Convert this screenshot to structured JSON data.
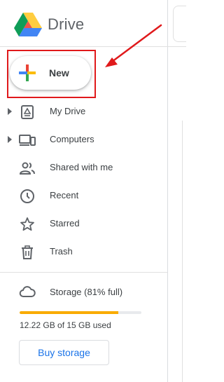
{
  "app": {
    "brand": "Drive"
  },
  "new_button": {
    "label": "New"
  },
  "nav": {
    "items": [
      {
        "id": "my-drive",
        "label": "My Drive",
        "icon": "drive-folder-icon",
        "expandable": true
      },
      {
        "id": "computers",
        "label": "Computers",
        "icon": "computers-icon",
        "expandable": true
      },
      {
        "id": "shared",
        "label": "Shared with me",
        "icon": "people-icon",
        "expandable": false
      },
      {
        "id": "recent",
        "label": "Recent",
        "icon": "clock-icon",
        "expandable": false
      },
      {
        "id": "starred",
        "label": "Starred",
        "icon": "star-icon",
        "expandable": false
      },
      {
        "id": "trash",
        "label": "Trash",
        "icon": "trash-icon",
        "expandable": false
      }
    ]
  },
  "storage": {
    "label": "Storage (81% full)",
    "used_fraction": 0.81,
    "used_text": "12.22 GB of 15 GB used",
    "bar_color": "#f9ab00",
    "buy_label": "Buy storage"
  },
  "colors": {
    "annotation": "#e0191b",
    "accent_blue": "#1a73e8",
    "text": "#3c4043"
  }
}
